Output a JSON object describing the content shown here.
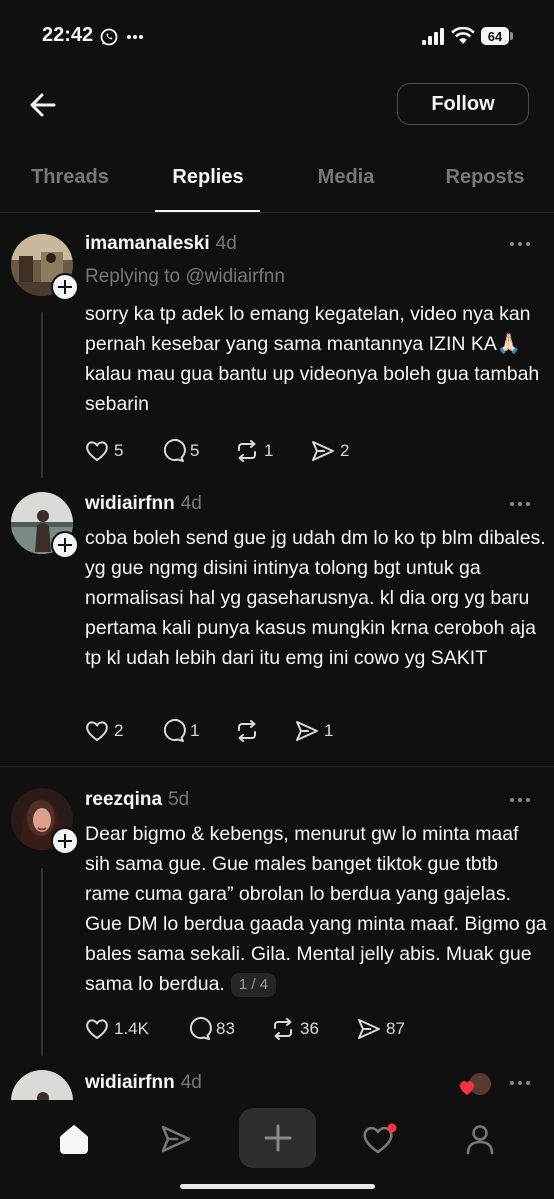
{
  "status_bar": {
    "time": "22:42",
    "battery": "64"
  },
  "header": {
    "follow_label": "Follow"
  },
  "tabs": [
    {
      "label": "Threads",
      "active": false
    },
    {
      "label": "Replies",
      "active": true
    },
    {
      "label": "Media",
      "active": false
    },
    {
      "label": "Reposts",
      "active": false
    }
  ],
  "posts": [
    {
      "username": "imamanaleski",
      "time": "4d",
      "replying_to": "Replying to @widiairfnn",
      "text": "sorry ka tp adek lo emang kegatelan, video nya kan pernah kesebar yang sama mantannya IZIN KA🙏🏻 kalau mau gua bantu up videonya boleh gua tambah sebarin",
      "likes": "5",
      "replies": "5",
      "reposts": "1",
      "shares": "2"
    },
    {
      "username": "widiairfnn",
      "time": "4d",
      "text": "coba boleh send gue jg udah dm lo ko tp blm dibales. yg gue ngmg disini intinya tolong bgt untuk ga normalisasi hal yg gaseharusnya. kl dia org yg baru pertama kali punya kasus mungkin krna ceroboh aja tp kl udah lebih dari itu emg ini cowo yg SAKIT",
      "likes": "2",
      "replies": "1",
      "reposts": "",
      "shares": "1"
    },
    {
      "username": "reezqina",
      "time": "5d",
      "text": "Dear bigmo & kebengs, menurut gw lo minta maaf sih sama gue. Gue males banget tiktok gue tbtb rame cuma gara” obrolan lo berdua yang gajelas. Gue DM lo berdua gaada yang minta maaf. Bigmo ga bales sama sekali. Gila. Mental jelly abis. Muak gue sama lo berdua.",
      "pager": "1 / 4",
      "likes": "1.4K",
      "replies": "83",
      "reposts": "36",
      "shares": "87"
    },
    {
      "username": "widiairfnn",
      "time": "4d"
    }
  ]
}
